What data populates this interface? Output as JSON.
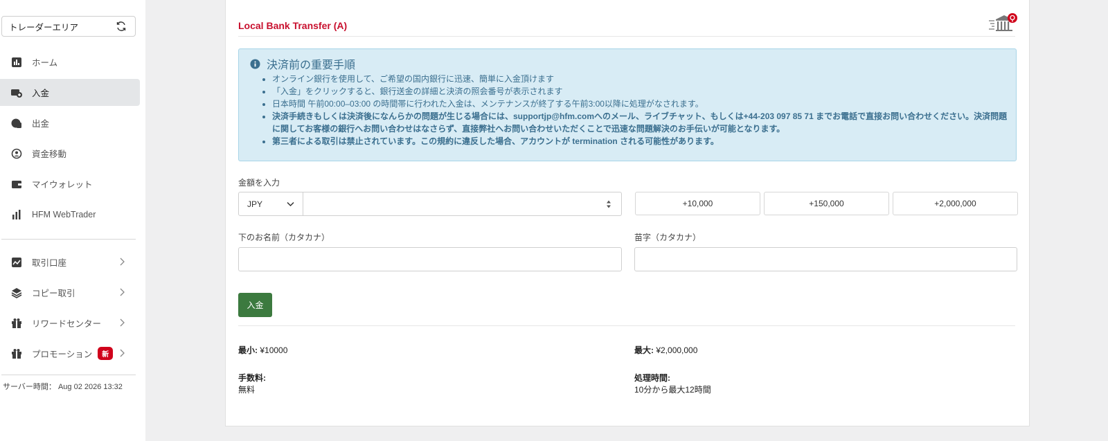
{
  "sidebar": {
    "trader_area": "トレーダーエリア",
    "items": [
      {
        "label": "ホーム",
        "icon": "chart-bar-icon"
      },
      {
        "label": "入金",
        "icon": "deposit-icon"
      },
      {
        "label": "出金",
        "icon": "withdraw-icon"
      },
      {
        "label": "資金移動",
        "icon": "transfer-icon"
      },
      {
        "label": "マイウォレット",
        "icon": "wallet-icon"
      },
      {
        "label": "HFM WebTrader",
        "icon": "webtrader-icon"
      }
    ],
    "items2": [
      {
        "label": "取引口座",
        "icon": "chart-area-icon"
      },
      {
        "label": "コピー取引",
        "icon": "layers-icon"
      },
      {
        "label": "リワードセンター",
        "icon": "gift-icon"
      },
      {
        "label": "プロモーション",
        "icon": "gift-icon",
        "badge": "新"
      }
    ],
    "server_time": "サーバー時間： Aug 02 2026 13:32",
    "active_color": "#e4e6e8"
  },
  "main": {
    "title": "Local Bank Transfer (A)",
    "notice": {
      "heading": "決済前の重要手順",
      "items": [
        "オンライン銀行を使用して、ご希望の国内銀行に迅速、簡単に入金頂けます",
        "「入金」をクリックすると、銀行送金の詳細と決済の照会番号が表示されます",
        "日本時間 午前00:00–03:00 の時間帯に行われた入金は、メンテナンスが終了する午前3:00以降に処理がなされます。",
        "決済手続きもしくは決済後になんらかの問題が生じる場合には、supportjp@hfm.comへのメール、ライブチャット、もしくは+44-203 097 85 71 までお電話で直接お問い合わせください。決済問題に関してお客様の銀行へお問い合わせはなさらず、直接弊社へお問い合わせいただくことで迅速な問題解決のお手伝いが可能となります。",
        "第三者による取引は禁止されています。この規約に違反した場合、アカウントが termination される可能性があります。"
      ]
    },
    "amount_label": "金額を入力",
    "currency": "JPY",
    "amount_value": "",
    "quick_amounts": [
      "+10,000",
      "+150,000",
      "+2,000,000"
    ],
    "first_name_label": "下のお名前（カタカナ）",
    "last_name_label": "苗字（カタカナ）",
    "submit_label": "入金",
    "min_label": "最小:",
    "min_value": "¥10000",
    "max_label": "最大:",
    "max_value": "¥2,000,000",
    "fee_label": "手数料:",
    "fee_value": "無料",
    "processing_label": "処理時間:",
    "processing_value": "10分から最大12時間",
    "colors": {
      "brand_red": "#c8102e",
      "submit_green": "#3c7a3f",
      "notice_bg": "#d8ecf5"
    }
  }
}
